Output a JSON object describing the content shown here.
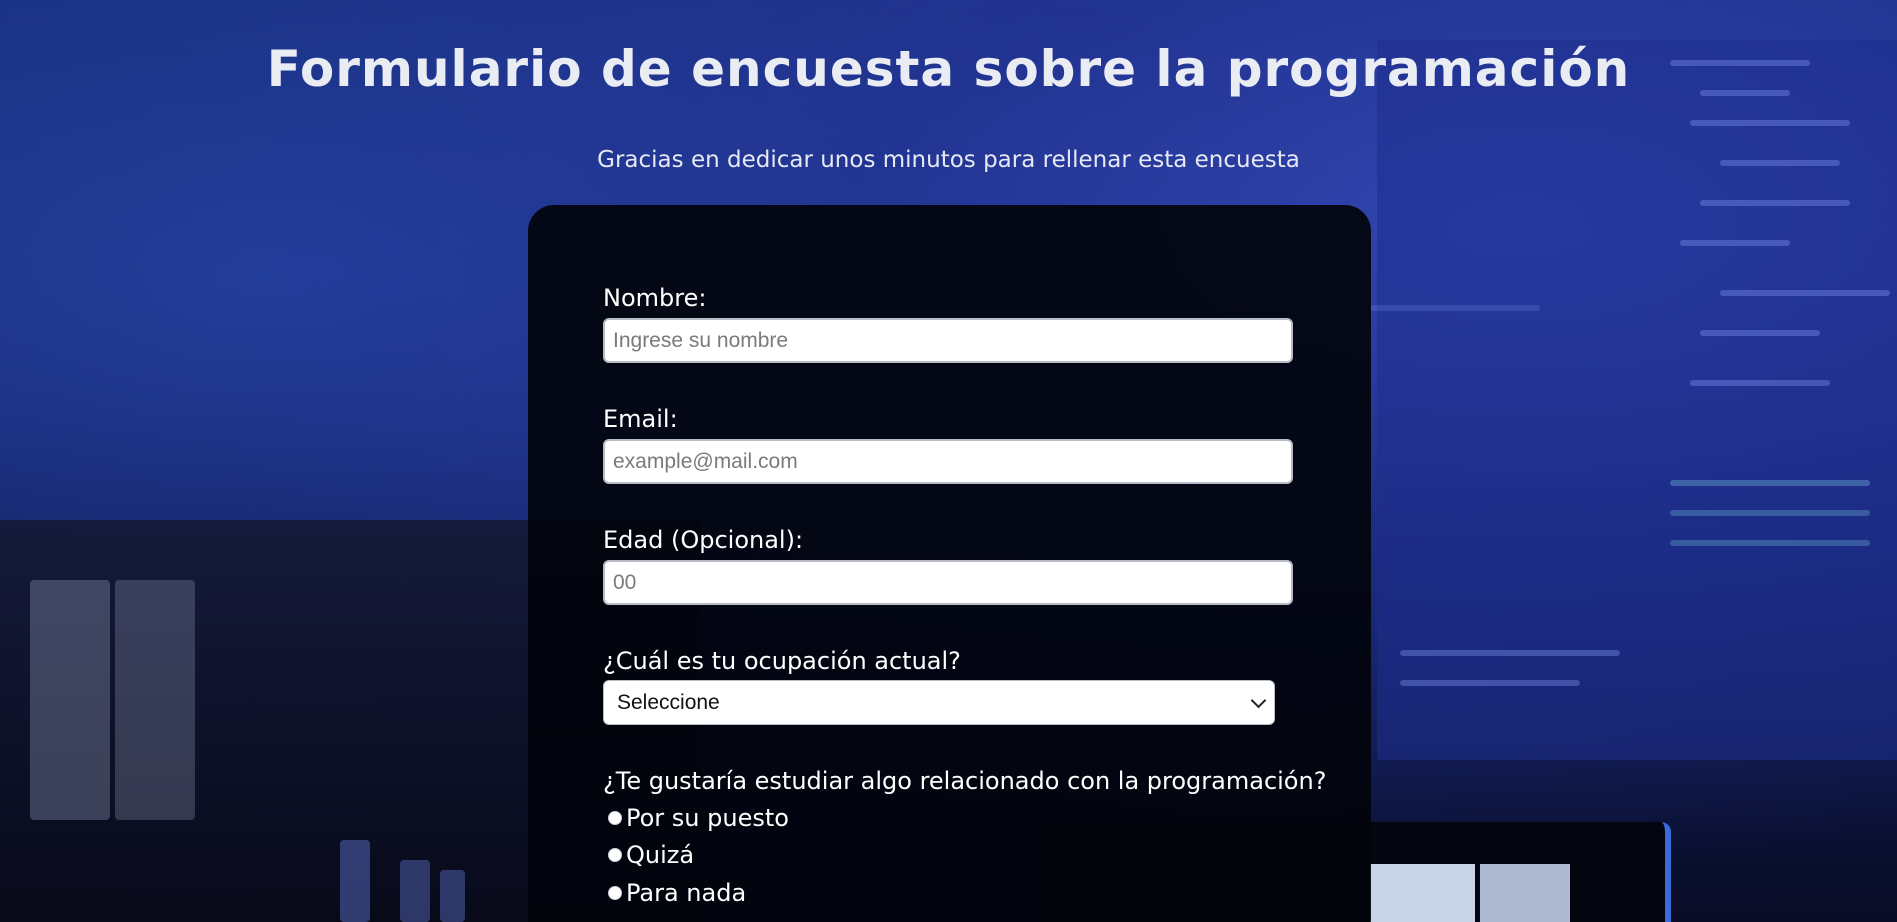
{
  "header": {
    "title": "Formulario de encuesta sobre la programación",
    "subtitle": "Gracias en dedicar unos minutos para rellenar esta encuesta"
  },
  "form": {
    "name": {
      "label": "Nombre:",
      "placeholder": "Ingrese su nombre",
      "value": ""
    },
    "email": {
      "label": "Email:",
      "placeholder": "example@mail.com",
      "value": ""
    },
    "age": {
      "label": "Edad (Opcional):",
      "placeholder": "00",
      "value": ""
    },
    "occupation": {
      "label": "¿Cuál es tu ocupación actual?",
      "selected": "Seleccione"
    },
    "study": {
      "question": "¿Te gustaría estudiar algo relacionado con la programación?",
      "options": [
        "Por su puesto",
        "Quizá",
        "Para nada"
      ]
    }
  },
  "colors": {
    "background_top": "#1a3585",
    "background_bottom": "#080c26",
    "card": "#02040c",
    "text": "#ffffff",
    "input_border": "#b7bcc6"
  }
}
